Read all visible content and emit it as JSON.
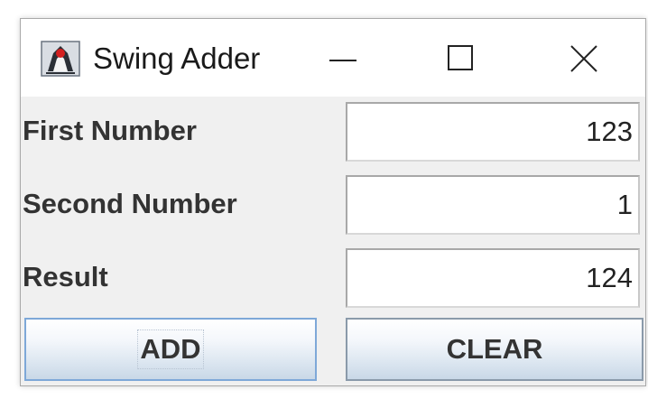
{
  "window": {
    "title": "Swing Adder",
    "controls": {
      "minimize_icon": "minimize-icon",
      "maximize_icon": "maximize-icon",
      "close_icon": "close-icon"
    }
  },
  "form": {
    "first_number": {
      "label": "First Number",
      "value": "123"
    },
    "second_number": {
      "label": "Second Number",
      "value": "1"
    },
    "result": {
      "label": "Result",
      "value": "124"
    }
  },
  "buttons": {
    "add": "ADD",
    "clear": "CLEAR"
  },
  "colors": {
    "window_bg": "#f0f0f0",
    "titlebar_bg": "#ffffff",
    "button_gradient_top": "#ffffff",
    "button_gradient_bottom": "#c9d8e7",
    "focused_button_border": "#7ea8d8"
  }
}
